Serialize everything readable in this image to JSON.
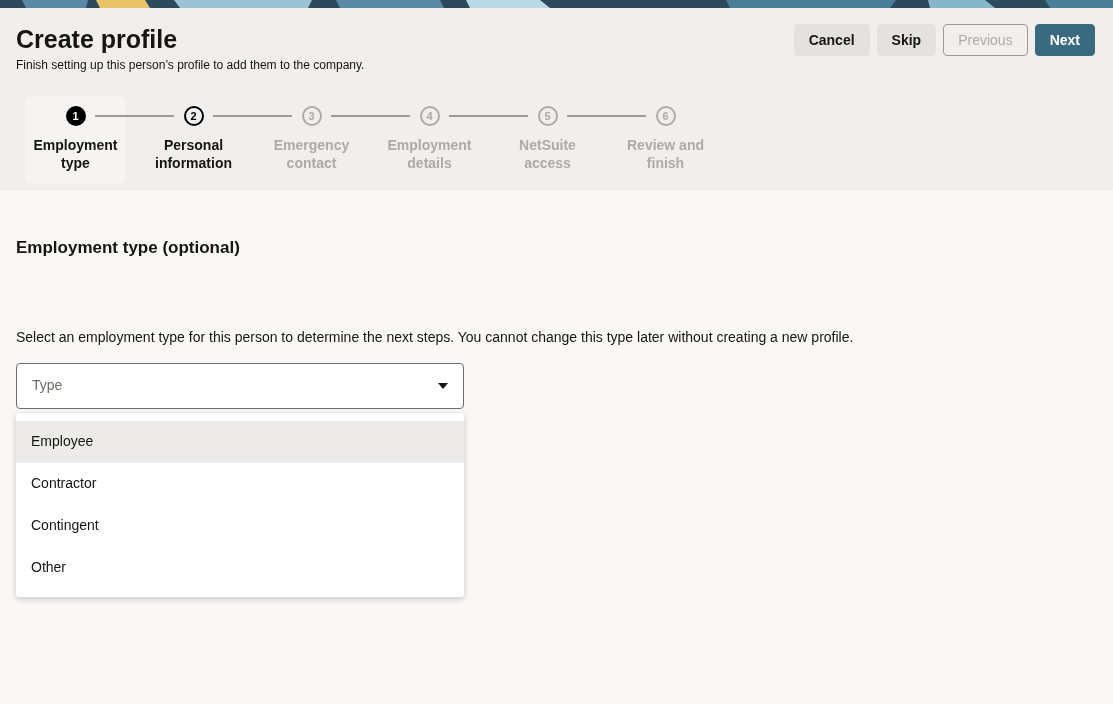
{
  "header": {
    "title": "Create profile",
    "subtitle": "Finish setting up this person’s profile to add them to the company."
  },
  "buttons": [
    {
      "label": "Cancel",
      "kind": "secondary",
      "disabled": false
    },
    {
      "label": "Skip",
      "kind": "secondary",
      "disabled": false
    },
    {
      "label": "Previous",
      "kind": "outlined",
      "disabled": true
    },
    {
      "label": "Next",
      "kind": "primary",
      "disabled": false
    }
  ],
  "steps": [
    {
      "number": "1",
      "label": "Employment type",
      "selected": true,
      "enabled": true
    },
    {
      "number": "2",
      "label": "Personal information",
      "selected": false,
      "enabled": true
    },
    {
      "number": "3",
      "label": "Emergency contact",
      "selected": false,
      "enabled": false
    },
    {
      "number": "4",
      "label": "Employment details",
      "selected": false,
      "enabled": false
    },
    {
      "number": "5",
      "label": "NetSuite access",
      "selected": false,
      "enabled": false
    },
    {
      "number": "6",
      "label": "Review and finish",
      "selected": false,
      "enabled": false
    }
  ],
  "section": {
    "title": "Employment type (optional)",
    "description": "Select an employment type for this person to determine the next steps. You cannot change this type later without creating a new profile."
  },
  "type_select": {
    "placeholder": "Type",
    "expanded": true,
    "options": [
      {
        "label": "Employee",
        "highlighted": true
      },
      {
        "label": "Contractor",
        "highlighted": false
      },
      {
        "label": "Contingent",
        "highlighted": false
      },
      {
        "label": "Other",
        "highlighted": false
      }
    ]
  }
}
